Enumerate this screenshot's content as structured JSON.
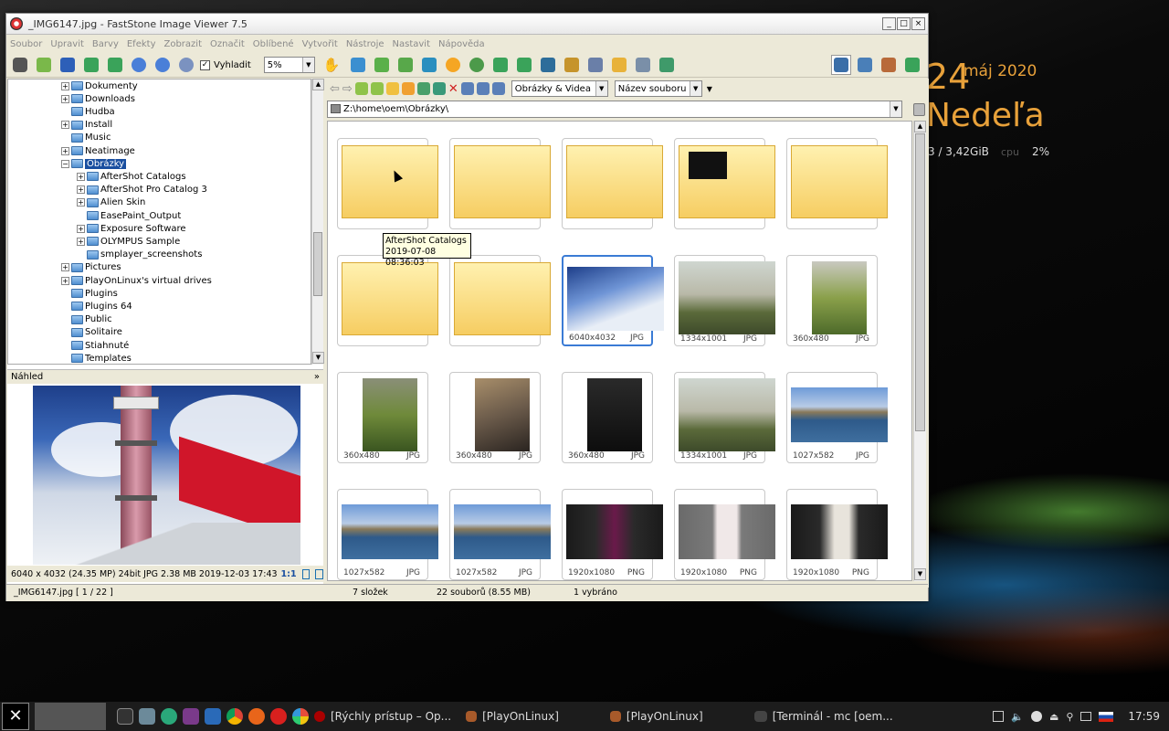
{
  "desktop": {
    "date_suffix": "máj 2020",
    "big_digit": "24",
    "day": "Nedeľa",
    "mem": "3 / 3,42GiB",
    "cpu_label": "cpu",
    "cpu_value": "2%"
  },
  "window": {
    "title": "_IMG6147.jpg - FastStone Image Viewer 7.5",
    "min": "_",
    "max": "□",
    "close": "×"
  },
  "menu": [
    "Soubor",
    "Upravit",
    "Barvy",
    "Efekty",
    "Zobrazit",
    "Označit",
    "Oblíbené",
    "Vytvořit",
    "Nástroje",
    "Nastavit",
    "Nápověda"
  ],
  "toolbar": {
    "smooth_label": "Vyhladit",
    "zoom_value": "5%"
  },
  "tree": [
    {
      "label": "Dokumenty",
      "level": 0,
      "exp": "+"
    },
    {
      "label": "Downloads",
      "level": 0,
      "exp": "+"
    },
    {
      "label": "Hudba",
      "level": 0,
      "exp": ""
    },
    {
      "label": "Install",
      "level": 0,
      "exp": "+"
    },
    {
      "label": "Music",
      "level": 0,
      "exp": ""
    },
    {
      "label": "Neatimage",
      "level": 0,
      "exp": "+"
    },
    {
      "label": "Obrázky",
      "level": 0,
      "exp": "−",
      "selected": true
    },
    {
      "label": "AfterShot Catalogs",
      "level": 1,
      "exp": "+"
    },
    {
      "label": "AfterShot Pro Catalog 3",
      "level": 1,
      "exp": "+"
    },
    {
      "label": "Alien Skin",
      "level": 1,
      "exp": "+"
    },
    {
      "label": "EasePaint_Output",
      "level": 1,
      "exp": ""
    },
    {
      "label": "Exposure Software",
      "level": 1,
      "exp": "+"
    },
    {
      "label": "OLYMPUS Sample",
      "level": 1,
      "exp": "+"
    },
    {
      "label": "smplayer_screenshots",
      "level": 1,
      "exp": ""
    },
    {
      "label": "Pictures",
      "level": 0,
      "exp": "+"
    },
    {
      "label": "PlayOnLinux's virtual drives",
      "level": 0,
      "exp": "+"
    },
    {
      "label": "Plugins",
      "level": 0,
      "exp": ""
    },
    {
      "label": "Plugins 64",
      "level": 0,
      "exp": ""
    },
    {
      "label": "Public",
      "level": 0,
      "exp": ""
    },
    {
      "label": "Solitaire",
      "level": 0,
      "exp": ""
    },
    {
      "label": "Stiahnuté",
      "level": 0,
      "exp": ""
    },
    {
      "label": "Templates",
      "level": 0,
      "exp": ""
    }
  ],
  "preview": {
    "title": "Náhled",
    "info": "6040 x 4032 (24.35 MP)  24bit  JPG   2.38 MB   2019-12-03 17:43",
    "ratio": "1:1"
  },
  "browser": {
    "filter": "Obrázky & Videa",
    "sort": "Název souboru",
    "path": "Z:\\home\\oem\\Obrázky\\"
  },
  "tooltip": {
    "name": "AfterShot Catalogs",
    "date": "2019-07-08 08:36:03"
  },
  "thumbs": [
    {
      "kind": "folder",
      "dims": "",
      "type": ""
    },
    {
      "kind": "folder",
      "dims": "",
      "type": ""
    },
    {
      "kind": "folder",
      "dims": "",
      "type": ""
    },
    {
      "kind": "folder",
      "dims": "",
      "type": "",
      "inner": true
    },
    {
      "kind": "folder",
      "dims": "",
      "type": ""
    },
    {
      "kind": "folder",
      "dims": "",
      "type": ""
    },
    {
      "kind": "folder",
      "dims": "",
      "type": ""
    },
    {
      "kind": "photo",
      "dims": "6040x4032",
      "type": "JPG",
      "style": "tower",
      "selected": true
    },
    {
      "kind": "photo",
      "dims": "1334x1001",
      "type": "JPG",
      "style": "moto"
    },
    {
      "kind": "photo",
      "dims": "360x480",
      "type": "JPG",
      "style": "moto-tall"
    },
    {
      "kind": "photo",
      "dims": "360x480",
      "type": "JPG",
      "style": "grass-tall"
    },
    {
      "kind": "photo",
      "dims": "360x480",
      "type": "JPG",
      "style": "wheel-tall"
    },
    {
      "kind": "photo",
      "dims": "360x480",
      "type": "JPG",
      "style": "dark-tall"
    },
    {
      "kind": "photo",
      "dims": "1334x1001",
      "type": "JPG",
      "style": "moto"
    },
    {
      "kind": "photo",
      "dims": "1027x582",
      "type": "JPG",
      "style": "bridge"
    },
    {
      "kind": "photo",
      "dims": "1027x582",
      "type": "JPG",
      "style": "bridge"
    },
    {
      "kind": "photo",
      "dims": "1027x582",
      "type": "JPG",
      "style": "bridge"
    },
    {
      "kind": "photo",
      "dims": "1920x1080",
      "type": "PNG",
      "style": "screen-dark"
    },
    {
      "kind": "photo",
      "dims": "1920x1080",
      "type": "PNG",
      "style": "screen-grey"
    },
    {
      "kind": "photo",
      "dims": "1920x1080",
      "type": "PNG",
      "style": "screen-dark2"
    }
  ],
  "status": {
    "file": "_IMG6147.jpg [ 1 / 22 ]",
    "folders": "7 složek",
    "files": "22 souborů (8.55 MB)",
    "selected": "1 vybráno"
  },
  "taskbar": {
    "items": [
      "[Rýchly prístup – Op...",
      "[PlayOnLinux]",
      "[PlayOnLinux]",
      "[Terminál - mc [oem..."
    ],
    "clock": "17:59"
  }
}
